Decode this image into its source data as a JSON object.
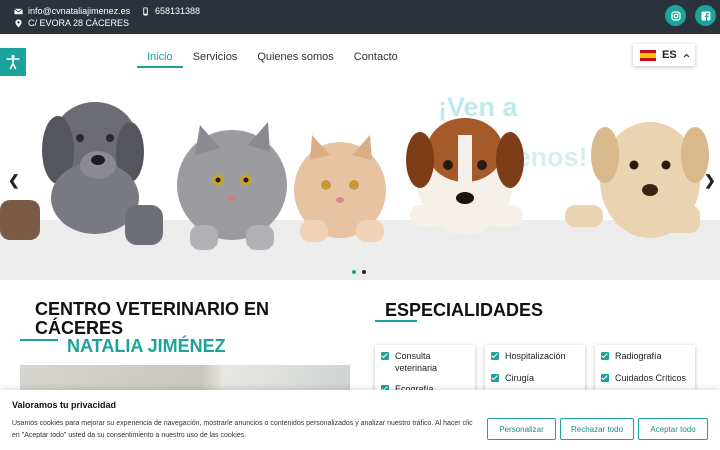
{
  "topbar": {
    "email": "info@cvnataliajimenez.es",
    "phone": "658131388",
    "address": "C/ EVORA 28 CÁCERES",
    "icons": [
      "mail-icon",
      "phone-icon",
      "map-pin-icon",
      "instagram-icon",
      "facebook-icon"
    ]
  },
  "nav": {
    "items": [
      "Inicio",
      "Servicios",
      "Quienes somos",
      "Contacto"
    ],
    "active": "Inicio"
  },
  "language": {
    "code": "ES"
  },
  "hero": {
    "line1": "¡Ven a",
    "line2": "conócenos!",
    "slide_count": 2,
    "active_slide": 1
  },
  "about": {
    "title": "CENTRO VETERINARIO EN CÁCERES",
    "subtitle": "NATALIA JIMÉNEZ"
  },
  "specialties": {
    "title": "ESPECIALIDADES",
    "col1": [
      "Consulta veterinaria",
      "Ecografía"
    ],
    "col2": [
      "Hospitalización",
      "Cirugía"
    ],
    "col3": [
      "Radiografía",
      "Cuidados Críticos"
    ]
  },
  "cookie": {
    "title": "Valoramos tu privacidad",
    "text": "Usamos cookies para mejorar su experiencia de navegación, mostrarle anuncios o contenidos personalizados y analizar nuestro tráfico. Al hacer clic en \"Aceptar todo\" usted da su consentimiento a nuestro uso de las cookies.",
    "customize": "Personalizar",
    "reject": "Rechazar todo",
    "accept": "Aceptar todo"
  },
  "colors": {
    "accent": "#1ba39c",
    "topbar": "#2b323b"
  }
}
